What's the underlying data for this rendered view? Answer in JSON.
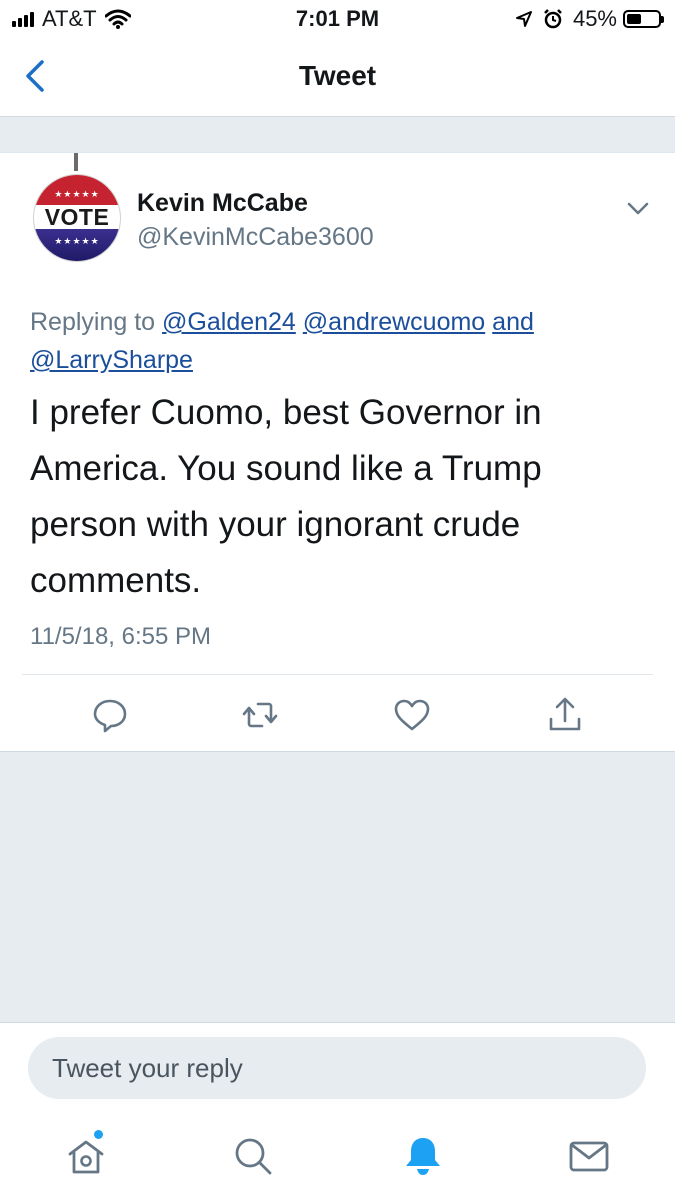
{
  "status_bar": {
    "carrier": "AT&T",
    "time": "7:01 PM",
    "battery": "45%",
    "battery_level": 0.45,
    "icons": [
      "signal-icon",
      "wifi-icon",
      "location-icon",
      "alarm-icon",
      "battery-icon"
    ]
  },
  "nav": {
    "title": "Tweet",
    "back_icon": "chevron-left-icon"
  },
  "tweet": {
    "avatar": {
      "text": "VOTE",
      "stars": "★★★★★"
    },
    "display_name": "Kevin McCabe",
    "handle": "@KevinMcCabe3600",
    "replying_prefix": "Replying to ",
    "mentions": [
      "@Galden24",
      "@andrewcuomo",
      "@LarrySharpe"
    ],
    "replying_and": "and",
    "text": "I prefer Cuomo, best Governor in America.  You sound like a Trump person with your ignorant crude comments.",
    "timestamp": "11/5/18, 6:55 PM",
    "actions": [
      "reply-icon",
      "retweet-icon",
      "like-icon",
      "share-icon"
    ]
  },
  "reply": {
    "placeholder": "Tweet your reply"
  },
  "tab_bar": {
    "items": [
      "home-icon",
      "search-icon",
      "notifications-icon",
      "messages-icon"
    ],
    "active": "notifications-icon"
  },
  "colors": {
    "accent": "#1da1f2",
    "link": "#1b4f9c",
    "secondary_text": "#657786",
    "background": "#e6ecf0"
  }
}
